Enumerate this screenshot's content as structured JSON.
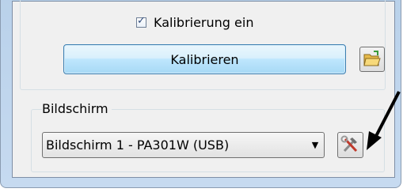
{
  "calibration": {
    "checkbox_label": "Kalibrierung ein",
    "checkbox_checked": true,
    "button_label": "Kalibrieren"
  },
  "screen_group": {
    "label": "Bildschirm",
    "selected_display": "Bildschirm 1 - PA301W (USB)"
  },
  "icons": {
    "folder": "open-folder-icon",
    "tools": "hammer-wrench-icon",
    "dropdown": "chevron-down-icon",
    "annotation": "arrow-icon"
  },
  "colors": {
    "window_frame": "#b9d1ea",
    "button_accent": "#3c7fb1",
    "annotation_arrow": "#000000"
  }
}
